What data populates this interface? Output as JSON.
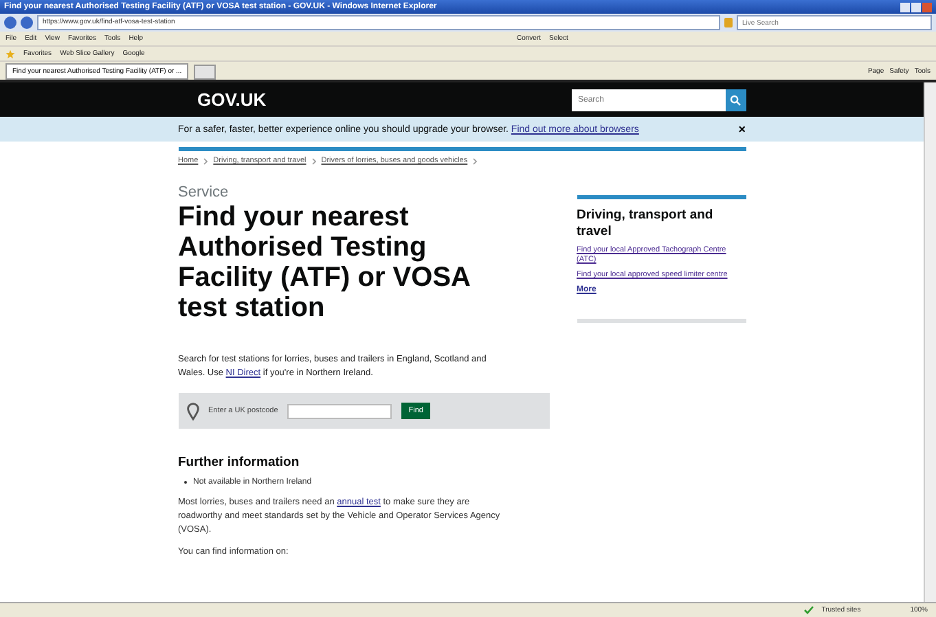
{
  "window": {
    "title": "Find your nearest Authorised Testing Facility (ATF) or VOSA test station - GOV.UK - Windows Internet Explorer"
  },
  "address_bar": {
    "url": "https://www.gov.uk/find-atf-vosa-test-station",
    "search_placeholder": "Live Search"
  },
  "menu": [
    "File",
    "Edit",
    "View",
    "Favorites",
    "Tools",
    "Help"
  ],
  "toolbar": [
    "Convert",
    "Select"
  ],
  "favorites_bar": {
    "label": "Favorites",
    "items": [
      "Web Slice Gallery",
      "Google"
    ]
  },
  "tabs": [
    {
      "label": "Find your nearest Authorised Testing Facility (ATF) or ...",
      "selected": true
    }
  ],
  "command_bar": [
    "Page",
    "Safety",
    "Tools"
  ],
  "site_header": {
    "logo": "GOV.UK",
    "search_placeholder": "Search"
  },
  "banner": {
    "text": "For a safer, faster, better experience online you should upgrade your browser.",
    "link": "Find out more about browsers",
    "close": "×"
  },
  "breadcrumbs": [
    "Home",
    "Driving, transport and travel",
    "Drivers of lorries, buses and goods vehicles"
  ],
  "main": {
    "kicker": "Service",
    "heading": "Find your nearest Authorised Testing Facility (ATF) or VOSA test station",
    "intro_before": "Search for test stations for lorries, buses and trailers in England, Scotland and Wales. Use",
    "intro_link": "NI Direct",
    "intro_after": "if you're in Northern Ireland.",
    "postcode_label": "Enter a UK postcode",
    "find_button": "Find",
    "further_heading": "Further information",
    "bullets": [
      "Not available in Northern Ireland"
    ],
    "body_before": "Most lorries, buses and trailers need an",
    "body_link": "annual test",
    "body_after": "to make sure they are roadworthy and meet standards set by the Vehicle and Operator Services Agency (VOSA).",
    "find_info": "You can find information on:"
  },
  "sidebar": {
    "heading": "Driving, transport and travel",
    "links": [
      "Find your local Approved Tachograph Centre (ATC)",
      "Find your local approved speed limiter centre"
    ],
    "more": "More"
  },
  "status_bar": {
    "zone": "Trusted sites",
    "zoom": "100%"
  }
}
